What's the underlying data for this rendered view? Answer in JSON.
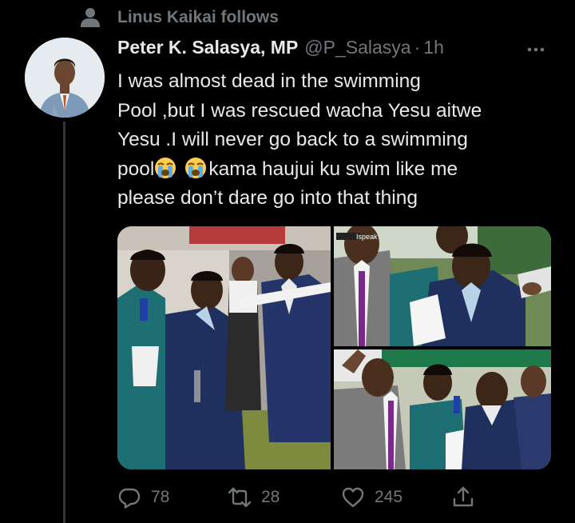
{
  "social_context": {
    "text": "Linus Kaikai follows",
    "icon": "person-icon"
  },
  "tweet": {
    "author_name": "Peter K. Salasya, MP",
    "handle": "@P_Salasya",
    "separator": "·",
    "time": "1h",
    "text_parts": {
      "before_emoji": "I was almost dead in the swimming\nPool ,but I was rescued wacha Yesu aitwe\nYesu .I will never go back to a swimming\npool",
      "after_emoji": "kama haujui ku swim like me\nplease don’t dare go into that thing"
    },
    "emoji": [
      "loudly-crying-face",
      "loudly-crying-face"
    ],
    "media_watermark": "Ispeak"
  },
  "actions": {
    "reply_count": "78",
    "retweet_count": "28",
    "like_count": "245"
  },
  "colors": {
    "background": "#000000",
    "text": "#e7e9ea",
    "muted": "#71767b",
    "divider": "#333639"
  }
}
